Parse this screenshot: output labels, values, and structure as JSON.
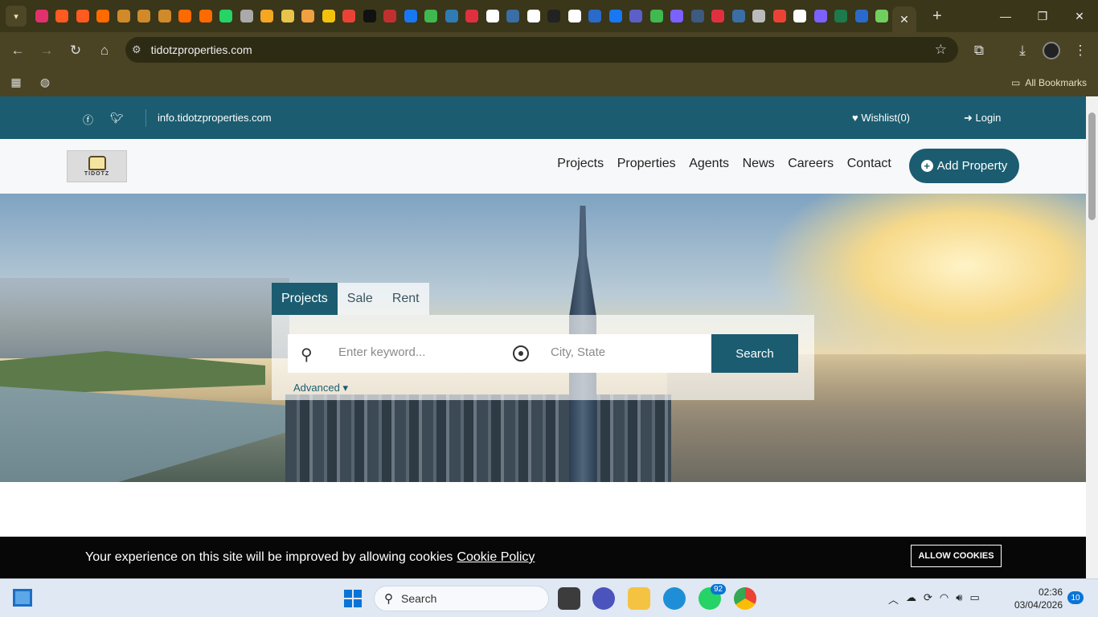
{
  "browser": {
    "active_tab_close": "✕",
    "new_tab": "+",
    "address": "tidotzproperties.com",
    "all_bookmarks": "All Bookmarks",
    "pinned_tab_colors": [
      "#e1306c",
      "#ff5a1f",
      "#ff5a1f",
      "#ff6a00",
      "#d08a2a",
      "#d08a2a",
      "#d08a2a",
      "#ff6a00",
      "#ff6a00",
      "#25d366",
      "#aaaaaa",
      "#f5a623",
      "#e8c44a",
      "#f0a040",
      "#f4c20d",
      "#ea4335",
      "#111111",
      "#c03030",
      "#1877f2",
      "#3fb950",
      "#2f7bb5",
      "#e03040",
      "#ffffff",
      "#3a6ea5",
      "#ffffff",
      "#222222",
      "#ffffff",
      "#2a6acb",
      "#1877f2",
      "#5b5fc7",
      "#3fb950",
      "#7b61ff",
      "#3d5a80",
      "#e03040",
      "#3a6ea5",
      "#bbbbbb",
      "#ea4335",
      "#ffffff",
      "#7b61ff",
      "#1d7a4a",
      "#2a6acb",
      "#6fcf5f"
    ]
  },
  "site": {
    "email": "info.tidotzproperties.com",
    "wishlist": "Wishlist(0)",
    "login": "Login",
    "logo_text": "TIDOTZ",
    "nav": [
      "Projects",
      "Properties",
      "Agents",
      "News",
      "Careers",
      "Contact"
    ],
    "add_property": "Add Property",
    "search_tabs": [
      "Projects",
      "Sale",
      "Rent"
    ],
    "keyword_placeholder": "Enter keyword...",
    "city_placeholder": "City, State",
    "search_button": "Search",
    "advanced": "Advanced",
    "accent_color": "#1b5c70"
  },
  "cookie": {
    "message": "Your experience on this site will be improved by allowing cookies",
    "policy_link": "Cookie Policy",
    "allow": "ALLOW COOKIES"
  },
  "taskbar": {
    "search_label": "Search",
    "whatsapp_badge": "92",
    "time": "02:36",
    "date": "03/04/2026",
    "notifications": "10"
  }
}
